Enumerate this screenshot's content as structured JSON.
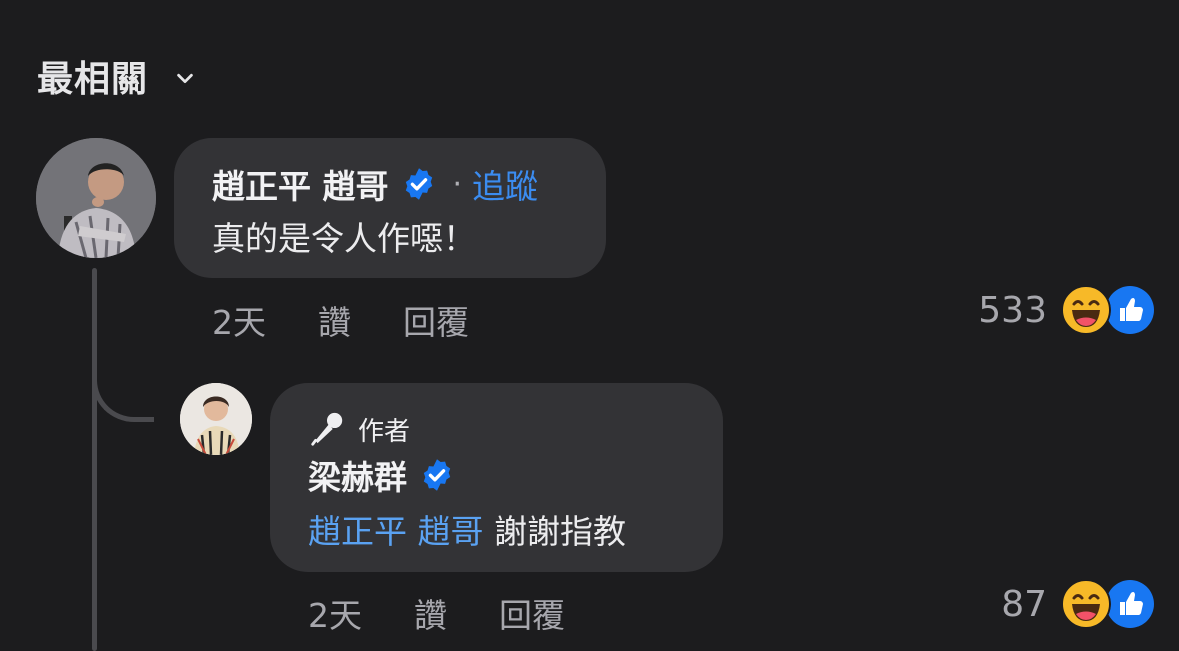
{
  "sort": {
    "label": "最相關"
  },
  "comments": [
    {
      "author": "趙正平 趙哥",
      "verified": true,
      "separator": "·",
      "follow_label": "追蹤",
      "text": "真的是令人作噁！",
      "time": "2天",
      "like_label": "讚",
      "reply_label": "回覆",
      "reaction_count": "533",
      "reactions": [
        "haha-emoji",
        "like-icon"
      ]
    }
  ],
  "reply": {
    "badge": "作者",
    "author": "梁赫群",
    "verified": true,
    "mention": "趙正平 趙哥",
    "text": " 謝謝指教",
    "time": "2天",
    "like_label": "讚",
    "reply_label": "回覆",
    "reaction_count": "87",
    "reactions": [
      "haha-emoji",
      "like-icon"
    ]
  },
  "colors": {
    "background": "#1c1c1e",
    "bubble": "#333336",
    "accent": "#3b8cf0",
    "verified": "#1877f2"
  }
}
